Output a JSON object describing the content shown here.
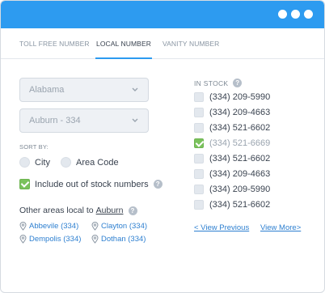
{
  "window": {
    "controls": [
      "dot",
      "dot",
      "dot"
    ]
  },
  "tabs": [
    {
      "label": "TOLL FREE NUMBER",
      "active": false
    },
    {
      "label": "LOCAL NUMBER",
      "active": true
    },
    {
      "label": "VANITY NUMBER",
      "active": false
    }
  ],
  "state_select": {
    "value": "Alabama"
  },
  "area_select": {
    "value": "Auburn - 334"
  },
  "sort": {
    "label": "SORT BY:",
    "options": [
      "City",
      "Area Code"
    ],
    "selected": null
  },
  "include_out_of_stock": {
    "label": "Include out of stock numbers",
    "checked": true
  },
  "other_areas": {
    "prefix": "Other areas local to",
    "city": "Auburn",
    "links": [
      "Abbevile (334)",
      "Clayton (334)",
      "Dempolis (334)",
      "Dothan (334)"
    ]
  },
  "in_stock": {
    "label": "IN STOCK",
    "numbers": [
      {
        "number": "(334) 209-5990",
        "checked": false
      },
      {
        "number": "(334) 209-4663",
        "checked": false
      },
      {
        "number": "(334) 521-6602",
        "checked": false
      },
      {
        "number": "(334) 521-6669",
        "checked": true
      },
      {
        "number": "(334) 521-6602",
        "checked": false
      },
      {
        "number": "(334) 209-4663",
        "checked": false
      },
      {
        "number": "(334) 209-5990",
        "checked": false
      },
      {
        "number": "(334) 521-6602",
        "checked": false
      }
    ]
  },
  "pager": {
    "previous": "< View Previous",
    "next": "View More>"
  },
  "colors": {
    "accent": "#2d9bf0",
    "link": "#2d7fd0",
    "check": "#7ac25c"
  },
  "icons": {
    "select": "chevron-down-icon",
    "help": "help-icon",
    "location": "location-pin-icon"
  }
}
